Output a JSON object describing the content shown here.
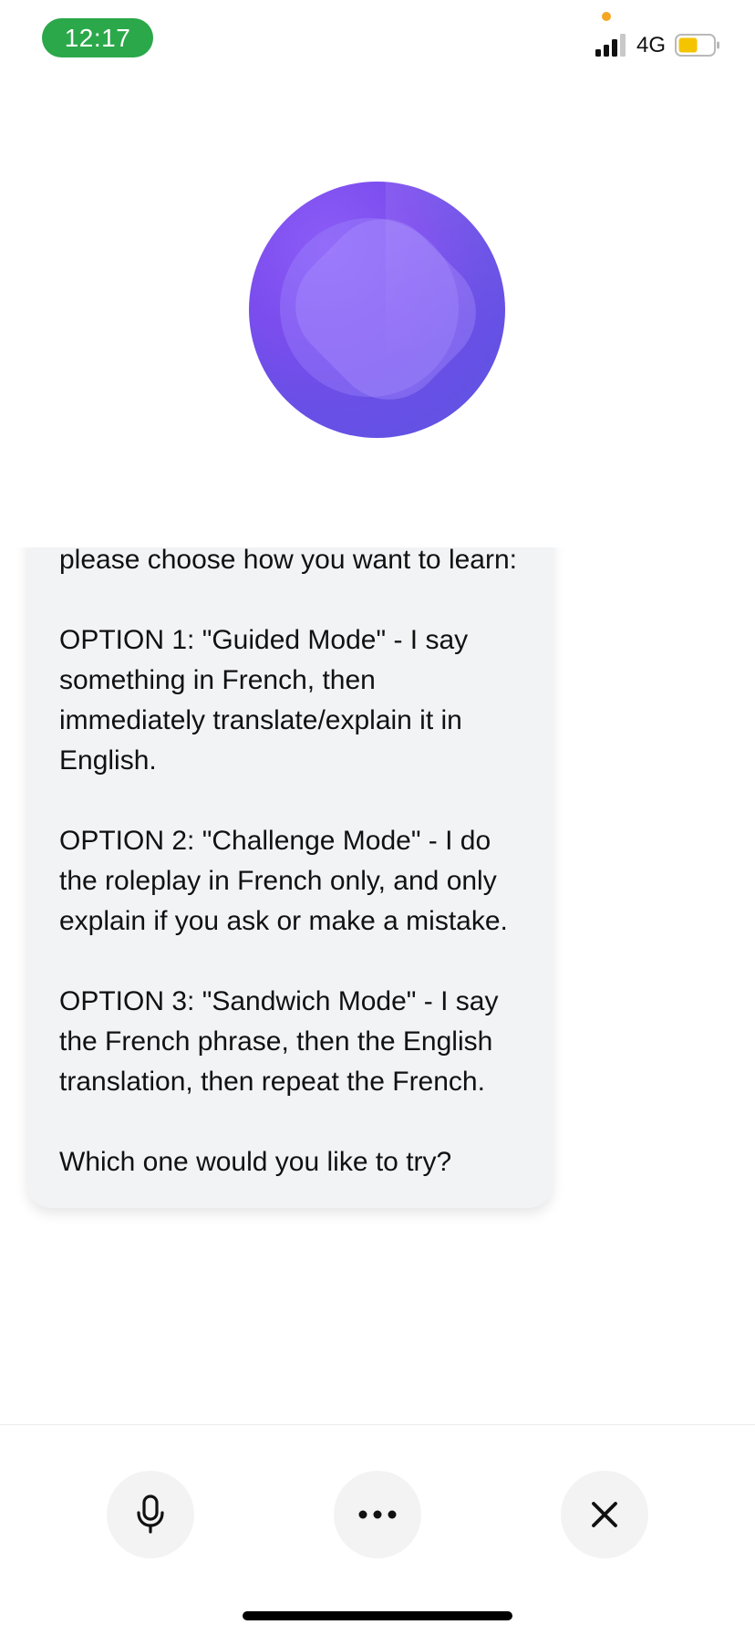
{
  "status_bar": {
    "time": "12:17",
    "network": "4G",
    "signal_bars_filled": 3,
    "signal_bars_total": 4,
    "battery_color": "#f5c400",
    "time_pill_color": "#2ba84a"
  },
  "orb": {
    "icon": "voice-orb",
    "colors": [
      "#8b5cf6",
      "#6a4fe6",
      "#5b55e2"
    ]
  },
  "message": {
    "paragraphs": [
      "please choose how you want to learn:",
      "OPTION 1: \"Guided Mode\" - I say something in French, then immediately translate/explain it in English.",
      "OPTION 2: \"Challenge Mode\" - I do the roleplay in French only, and only explain if you ask or make a mistake.",
      "OPTION 3: \"Sandwich Mode\" - I say the French phrase, then the English translation, then repeat the French.",
      "Which one would you like to try?"
    ]
  },
  "controls": {
    "mic_icon": "microphone-icon",
    "more_icon": "more-horizontal-icon",
    "close_icon": "close-icon"
  }
}
